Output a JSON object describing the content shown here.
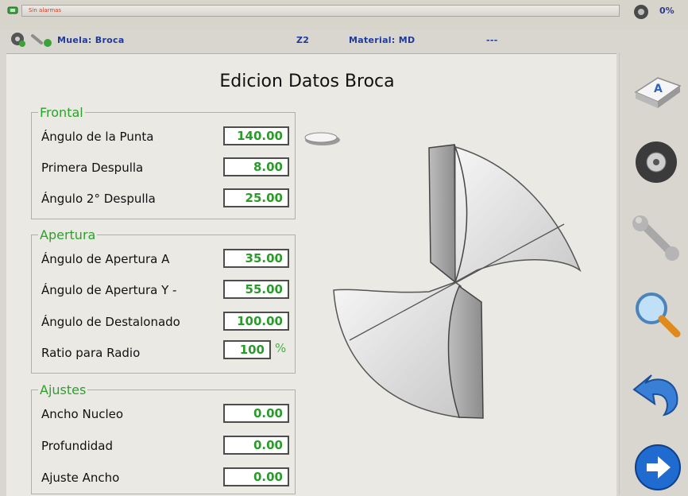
{
  "header": {
    "message": "Sin alarmas",
    "progress_percent": "0%",
    "wheel_label": "Muela: Broca",
    "z_label": "Z2",
    "material_label": "Material: MD",
    "extra": "---"
  },
  "page": {
    "title": "Edicion Datos Broca"
  },
  "frontal": {
    "title": "Frontal",
    "rows": [
      {
        "label": "Ángulo de la Punta",
        "value": "140.00"
      },
      {
        "label": "Primera Despulla",
        "value": "8.00"
      },
      {
        "label": "Ángulo 2° Despulla",
        "value": "25.00"
      }
    ]
  },
  "apertura": {
    "title": "Apertura",
    "rows": [
      {
        "label": "Ángulo de Apertura A",
        "value": "35.00"
      },
      {
        "label": "Ángulo de Apertura Y -",
        "value": "55.00"
      },
      {
        "label": "Ángulo de Destalonado",
        "value": "100.00"
      },
      {
        "label": "Ratio para Radio",
        "value": "100"
      }
    ],
    "ratio_unit": "%"
  },
  "ajustes": {
    "title": "Ajustes",
    "rows": [
      {
        "label": "Ancho Nucleo",
        "value": "0.00"
      },
      {
        "label": "Profundidad",
        "value": "0.00"
      },
      {
        "label": "Ajuste Ancho",
        "value": "0.00"
      }
    ]
  },
  "sidebar": {
    "buttons": [
      "keyboard-key",
      "grinding-wheel",
      "wrench",
      "magnifier",
      "undo-arrow",
      "next-arrow"
    ]
  },
  "colors": {
    "value_green": "#2a9b2a",
    "group_title_green": "#2da12d",
    "status_blue": "#1f3a99"
  }
}
